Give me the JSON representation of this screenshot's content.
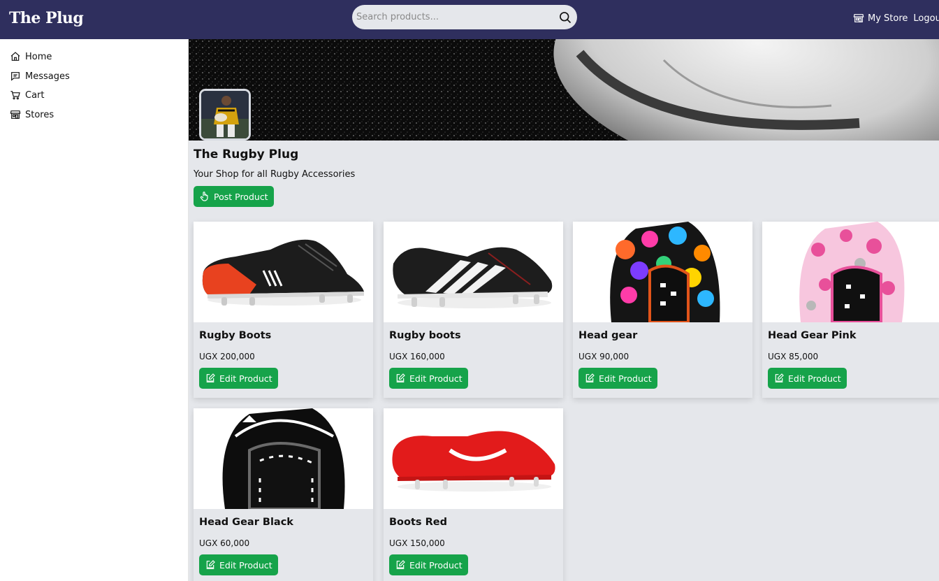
{
  "header": {
    "logo": "The Plug",
    "search_placeholder": "Search products...",
    "my_store_label": "My Store",
    "logout_label": "Logout",
    "bg_color": "#2f2f5e"
  },
  "sidebar": {
    "items": [
      {
        "label": "Home",
        "icon": "home-icon"
      },
      {
        "label": "Messages",
        "icon": "message-icon"
      },
      {
        "label": "Cart",
        "icon": "cart-icon"
      },
      {
        "label": "Stores",
        "icon": "store-icon"
      }
    ]
  },
  "store": {
    "name": "The Rugby Plug",
    "description": "Your Shop for all Rugby Accessories",
    "post_button_label": "Post Product"
  },
  "products": [
    {
      "name": "Rugby Boots",
      "price": "UGX 200,000",
      "edit_label": "Edit Product"
    },
    {
      "name": "Rugby boots",
      "price": "UGX 160,000",
      "edit_label": "Edit Product"
    },
    {
      "name": "Head gear",
      "price": "UGX 90,000",
      "edit_label": "Edit Product"
    },
    {
      "name": "Head Gear Pink",
      "price": "UGX 85,000",
      "edit_label": "Edit Product"
    },
    {
      "name": "Head Gear Black",
      "price": "UGX 60,000",
      "edit_label": "Edit Product"
    },
    {
      "name": "Boots Red",
      "price": "UGX 150,000",
      "edit_label": "Edit Product"
    }
  ],
  "colors": {
    "accent_green": "#16a34a",
    "main_bg": "#e5e7eb"
  }
}
